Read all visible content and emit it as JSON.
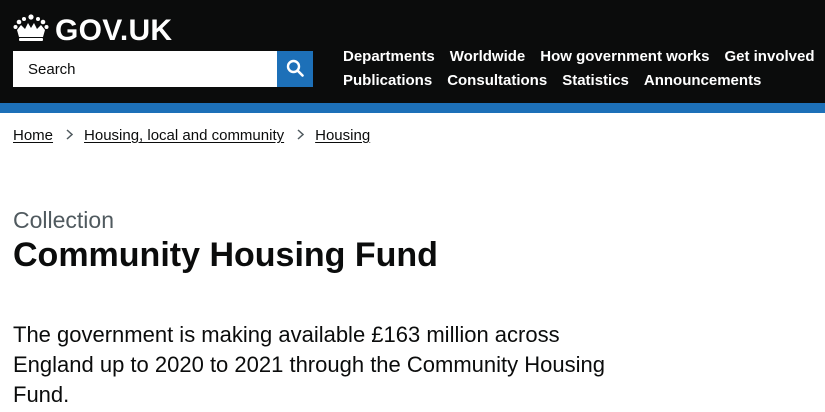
{
  "header": {
    "logo_text": "GOV.UK",
    "search": {
      "placeholder": "Search",
      "button_icon": "search-icon"
    },
    "nav": [
      {
        "label": "Departments"
      },
      {
        "label": "Worldwide"
      },
      {
        "label": "How government works"
      },
      {
        "label": "Get involved"
      },
      {
        "label": "Publications"
      },
      {
        "label": "Consultations"
      },
      {
        "label": "Statistics"
      },
      {
        "label": "Announcements"
      }
    ]
  },
  "breadcrumbs": [
    {
      "label": "Home"
    },
    {
      "label": "Housing, local and community"
    },
    {
      "label": "Housing"
    }
  ],
  "page": {
    "caption": "Collection",
    "title": "Community Housing Fund",
    "lead": "The government is making available £163 million across England up to 2020 to 2021 through the Community Housing Fund."
  },
  "colors": {
    "header_bg": "#0b0c0c",
    "accent_blue": "#1d70b8",
    "text": "#0b0c0c",
    "secondary_text": "#505a5f"
  }
}
